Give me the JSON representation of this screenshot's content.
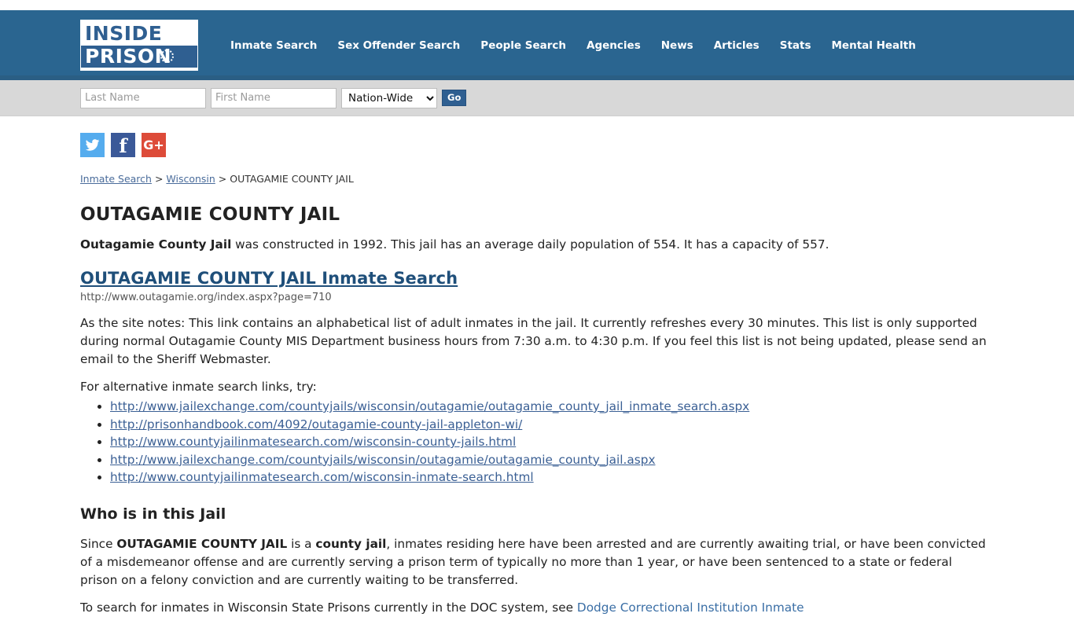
{
  "site": {
    "logo_line1": "INSIDE",
    "logo_line2": "PRISON",
    "header_color": "#2a6590",
    "logo_blue": "#2f5f91"
  },
  "nav": {
    "items": [
      {
        "label": "Inmate Search"
      },
      {
        "label": "Sex Offender Search"
      },
      {
        "label": "People Search"
      },
      {
        "label": "Agencies"
      },
      {
        "label": "News"
      },
      {
        "label": "Articles"
      },
      {
        "label": "Stats"
      },
      {
        "label": "Mental Health"
      }
    ]
  },
  "search": {
    "last_name_placeholder": "Last Name",
    "last_name_value": "",
    "first_name_placeholder": "First Name",
    "first_name_value": "",
    "scope_selected": "Nation-Wide",
    "scope_options": [
      "Nation-Wide"
    ],
    "go_label": "Go"
  },
  "social": {
    "twitter_name": "twitter-icon",
    "facebook_glyph": "f",
    "googleplus_glyph": "G+"
  },
  "breadcrumb": {
    "item1": "Inmate Search",
    "sep1": " > ",
    "item2": "Wisconsin",
    "sep2": " > ",
    "current": "OUTAGAMIE COUNTY JAIL"
  },
  "page": {
    "title": "OUTAGAMIE COUNTY JAIL",
    "intro_bold": "Outagamie County Jail",
    "intro_rest": " was constructed in 1992. This jail has an average daily population of 554. It has a capacity of 557.",
    "inmate_search_link": "OUTAGAMIE COUNTY JAIL Inmate Search",
    "inmate_search_url": "http://www.outagamie.org/index.aspx?page=710",
    "site_notes": "As the site notes: This link contains an alphabetical list of adult inmates in the jail. It currently refreshes every 30 minutes. This list is only supported during normal Outagamie County MIS Department business hours from 7:30 a.m. to 4:30 p.m. If you feel this list is not being updated, please send an email to the Sheriff Webmaster.",
    "alt_links_label": "For alternative inmate search links, try:",
    "alt_links": [
      "http://www.jailexchange.com/countyjails/wisconsin/outagamie/outagamie_county_jail_inmate_search.aspx",
      "http://prisonhandbook.com/4092/outagamie-county-jail-appleton-wi/",
      "http://www.countyjailinmatesearch.com/wisconsin-county-jails.html",
      "http://www.jailexchange.com/countyjails/wisconsin/outagamie/outagamie_county_jail.aspx",
      "http://www.countyjailinmatesearch.com/wisconsin-inmate-search.html"
    ],
    "who_heading": "Who is in this Jail",
    "who_p1_a": "Since ",
    "who_p1_b": "OUTAGAMIE COUNTY JAIL",
    "who_p1_c": " is a ",
    "who_p1_d": "county jail",
    "who_p1_e": ", inmates residing here have been arrested and are currently awaiting trial, or have been convicted of a misdemeanor offense and are currently serving a prison term of typically no more than 1 year, or have been sentenced to a state or federal prison on a felony conviction and are currently waiting to be transferred.",
    "bottom_text": "To search for inmates in Wisconsin State Prisons currently in the DOC system, see ",
    "bottom_link": "Dodge Correctional Institution Inmate"
  }
}
